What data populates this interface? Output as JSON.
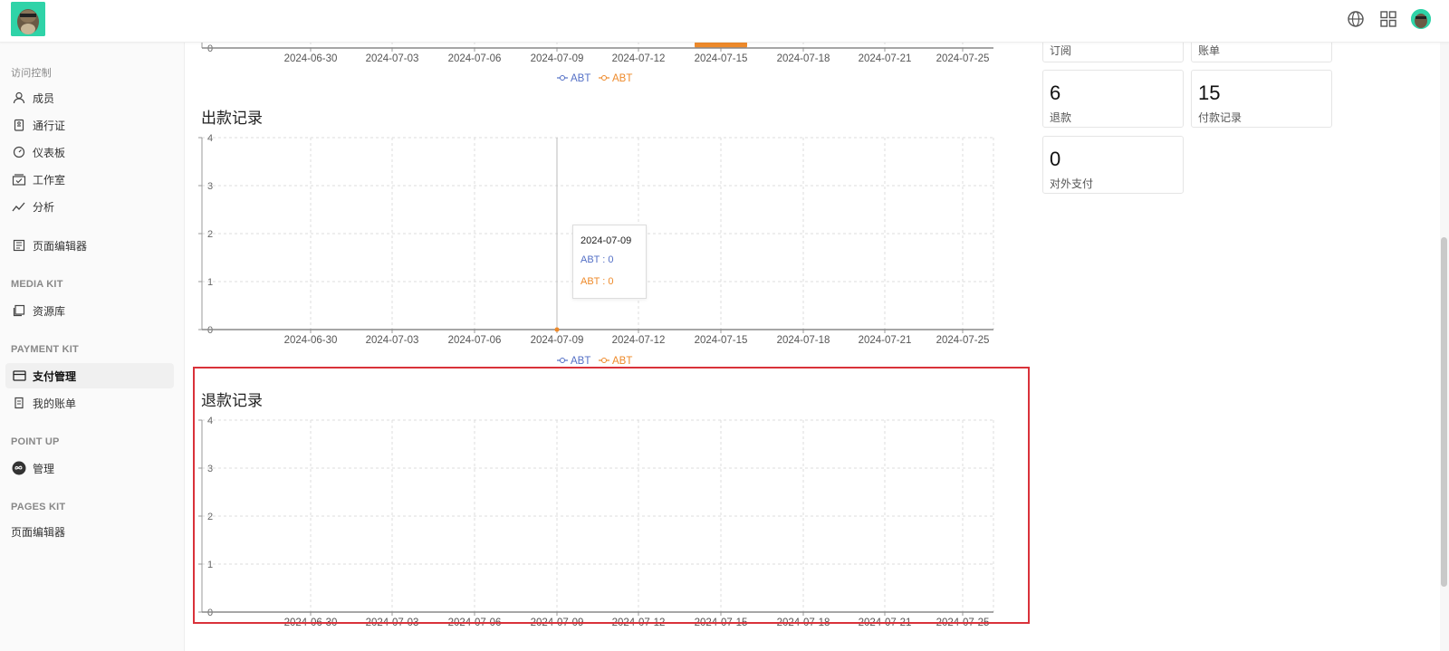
{
  "header": {
    "icons": [
      "globe-icon",
      "apps-grid-icon",
      "user-avatar"
    ]
  },
  "sidebar": {
    "sections": [
      {
        "title": "访问控制"
      },
      {
        "title": "MEDIA KIT"
      },
      {
        "title": "PAYMENT KIT"
      },
      {
        "title": "POINT UP"
      },
      {
        "title": "PAGES KIT"
      }
    ],
    "items": [
      {
        "label": "成员",
        "icon": "user-icon"
      },
      {
        "label": "通行证",
        "icon": "pass-icon"
      },
      {
        "label": "仪表板",
        "icon": "gauge-icon"
      },
      {
        "label": "工作室",
        "icon": "studio-icon"
      },
      {
        "label": "分析",
        "icon": "analytics-icon"
      },
      {
        "label": "页面编辑器",
        "icon": "page-editor-icon"
      },
      {
        "label": "资源库",
        "icon": "library-icon"
      },
      {
        "label": "支付管理",
        "icon": "card-icon"
      },
      {
        "label": "我的账单",
        "icon": "bill-icon"
      },
      {
        "label": "管理",
        "icon": "infinity-icon"
      },
      {
        "label": "页面编辑器"
      }
    ]
  },
  "stats": [
    {
      "label": "订阅"
    },
    {
      "label": "账单"
    },
    {
      "value": "6",
      "label": "退款"
    },
    {
      "value": "15",
      "label": "付款记录"
    },
    {
      "value": "0",
      "label": "对外支付"
    }
  ],
  "tooltip": {
    "date": "2024-07-09",
    "line_a": "ABT : 0",
    "line_b": "ABT : 0"
  },
  "colors": {
    "series_a": "#5470c6",
    "series_b": "#ee8a2a",
    "highlight": "#d9323a"
  },
  "chart_data": [
    {
      "type": "line",
      "categories": [
        "2024-06-30",
        "2024-07-03",
        "2024-07-06",
        "2024-07-09",
        "2024-07-12",
        "2024-07-15",
        "2024-07-18",
        "2024-07-21",
        "2024-07-25"
      ],
      "y_tick_labels": [
        "0"
      ],
      "series": [
        {
          "name": "ABT"
        },
        {
          "name": "ABT"
        }
      ],
      "legend": "bottom-center"
    },
    {
      "type": "line",
      "title": "出款记录",
      "categories": [
        "2024-06-30",
        "2024-07-03",
        "2024-07-06",
        "2024-07-09",
        "2024-07-12",
        "2024-07-15",
        "2024-07-18",
        "2024-07-21",
        "2024-07-25"
      ],
      "ylim": [
        0,
        4
      ],
      "y_ticks": [
        "0",
        "1",
        "2",
        "3",
        "4"
      ],
      "series": [
        {
          "name": "ABT",
          "values": []
        },
        {
          "name": "ABT",
          "values": []
        }
      ],
      "legend": "bottom-center",
      "grid": true
    },
    {
      "type": "line",
      "title": "退款记录",
      "categories": [
        "2024-06-30",
        "2024-07-03",
        "2024-07-06",
        "2024-07-09",
        "2024-07-12",
        "2024-07-15",
        "2024-07-18",
        "2024-07-21",
        "2024-07-25"
      ],
      "ylim": [
        0,
        4
      ],
      "y_ticks": [
        "0",
        "1",
        "2",
        "3",
        "4"
      ],
      "series": [],
      "grid": true
    }
  ]
}
